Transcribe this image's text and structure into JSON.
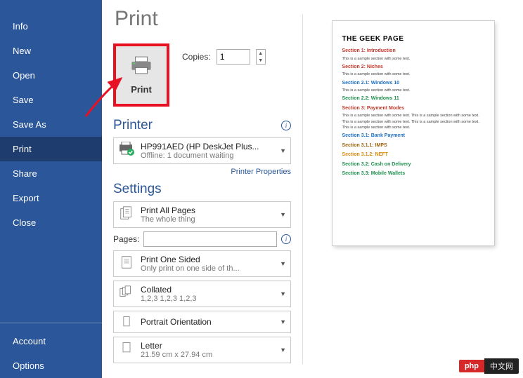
{
  "sidebar": {
    "items": [
      {
        "label": "Info"
      },
      {
        "label": "New"
      },
      {
        "label": "Open"
      },
      {
        "label": "Save"
      },
      {
        "label": "Save As"
      },
      {
        "label": "Print"
      },
      {
        "label": "Share"
      },
      {
        "label": "Export"
      },
      {
        "label": "Close"
      }
    ],
    "bottom": [
      {
        "label": "Account"
      },
      {
        "label": "Options"
      }
    ],
    "active_index": 5
  },
  "title": "Print",
  "print_button": {
    "label": "Print"
  },
  "copies": {
    "label": "Copies:",
    "value": "1"
  },
  "printer": {
    "heading": "Printer",
    "name": "HP991AED (HP DeskJet Plus...",
    "status": "Offline: 1 document waiting",
    "properties_link": "Printer Properties"
  },
  "settings": {
    "heading": "Settings",
    "print_pages": {
      "line1": "Print All Pages",
      "line2": "The whole thing"
    },
    "pages": {
      "label": "Pages:",
      "value": ""
    },
    "sides": {
      "line1": "Print One Sided",
      "line2": "Only print on one side of th..."
    },
    "collate": {
      "line1": "Collated",
      "line2": "1,2,3    1,2,3    1,2,3"
    },
    "orientation": {
      "line1": "Portrait Orientation"
    },
    "paper": {
      "line1": "Letter",
      "line2": "21.59 cm x 27.94 cm"
    }
  },
  "preview": {
    "title": "THE GEEK PAGE",
    "s1": "Section 1: Introduction",
    "b1": "This is a sample section with some text.",
    "s2": "Section 2: Niches",
    "b2": "This is a sample section with some text.",
    "s21": "Section 2.1: Windows 10",
    "b21": "This is a sample section with some text.",
    "s22": "Section 2.2: Windows 11",
    "s3": "Section 3: Payment Modes",
    "b3": "This is a sample section with some text. This is a sample section with some text. This is a sample section with some text. This is a sample section with some text. This is a sample section with some text.",
    "s31": "Section 3.1: Bank Payment",
    "s311": "Section 3.1.1: IMPS",
    "s312": "Section 3.1.2: NEFT",
    "s32": "Section 3.2: Cash on Delivery",
    "s33": "Section 3.3: Mobile Wallets"
  },
  "watermark": {
    "left": "php",
    "right": "中文网"
  }
}
